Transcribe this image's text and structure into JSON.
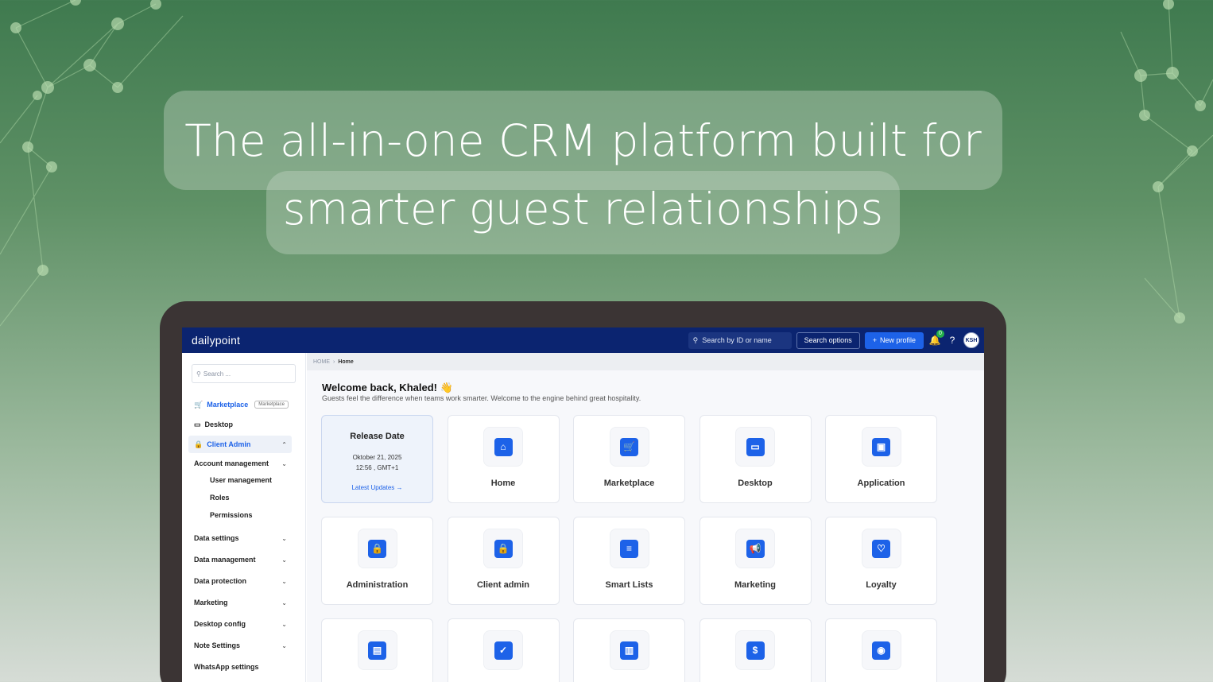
{
  "headline": {
    "line1": "The all-in-one CRM platform built for",
    "line2": "smarter guest relationships"
  },
  "app": {
    "brand": "dailypoint",
    "search_placeholder": "Search by ID or name",
    "search_options_label": "Search options",
    "new_profile_label": "New profile",
    "notification_count": "0",
    "avatar_initials": "KSH"
  },
  "sidebar": {
    "search_placeholder": "Search ...",
    "marketplace_label": "Marketplace",
    "marketplace_tag": "Marketplace",
    "desktop_label": "Desktop",
    "client_admin_label": "Client Admin",
    "account_management_label": "Account management",
    "sub_items": [
      "User management",
      "Roles",
      "Permissions"
    ],
    "sections": [
      "Data settings",
      "Data management",
      "Data protection",
      "Marketing",
      "Desktop config",
      "Note Settings",
      "WhatsApp settings"
    ]
  },
  "breadcrumb": {
    "root": "HOME",
    "current": "Home"
  },
  "welcome": {
    "title": "Welcome back, Khaled! 👋",
    "subtitle": "Guests feel the difference when teams work smarter. Welcome to the engine behind great hospitality."
  },
  "release": {
    "title": "Release Date",
    "date": "Oktober 21, 2025",
    "time": "12:56 , GMT+1",
    "link": "Latest Updates →"
  },
  "tiles": [
    {
      "label": "Home",
      "icon": "home-icon",
      "glyph": "⌂"
    },
    {
      "label": "Marketplace",
      "icon": "cart-icon",
      "glyph": "🛒"
    },
    {
      "label": "Desktop",
      "icon": "monitor-icon",
      "glyph": "▭"
    },
    {
      "label": "Application",
      "icon": "briefcase-icon",
      "glyph": "▣"
    },
    {
      "label": "Administration",
      "icon": "lock-icon",
      "glyph": "🔒"
    },
    {
      "label": "Client admin",
      "icon": "lock-icon",
      "glyph": "🔒"
    },
    {
      "label": "Smart Lists",
      "icon": "list-icon",
      "glyph": "≡"
    },
    {
      "label": "Marketing",
      "icon": "megaphone-icon",
      "glyph": "📢"
    },
    {
      "label": "Loyalty",
      "icon": "heart-icon",
      "glyph": "♡"
    },
    {
      "label": "",
      "icon": "book-icon",
      "glyph": "▤"
    },
    {
      "label": "",
      "icon": "check-circle-icon",
      "glyph": "✓"
    },
    {
      "label": "",
      "icon": "bar-chart-icon",
      "glyph": "▥"
    },
    {
      "label": "",
      "icon": "dollar-icon",
      "glyph": "$"
    },
    {
      "label": "",
      "icon": "rss-icon",
      "glyph": "◉"
    }
  ],
  "colors": {
    "topbar": "#0b2470",
    "accent": "#1d62e8",
    "background_top": "#3f7a4f",
    "laptop_frame": "#3b3434"
  }
}
